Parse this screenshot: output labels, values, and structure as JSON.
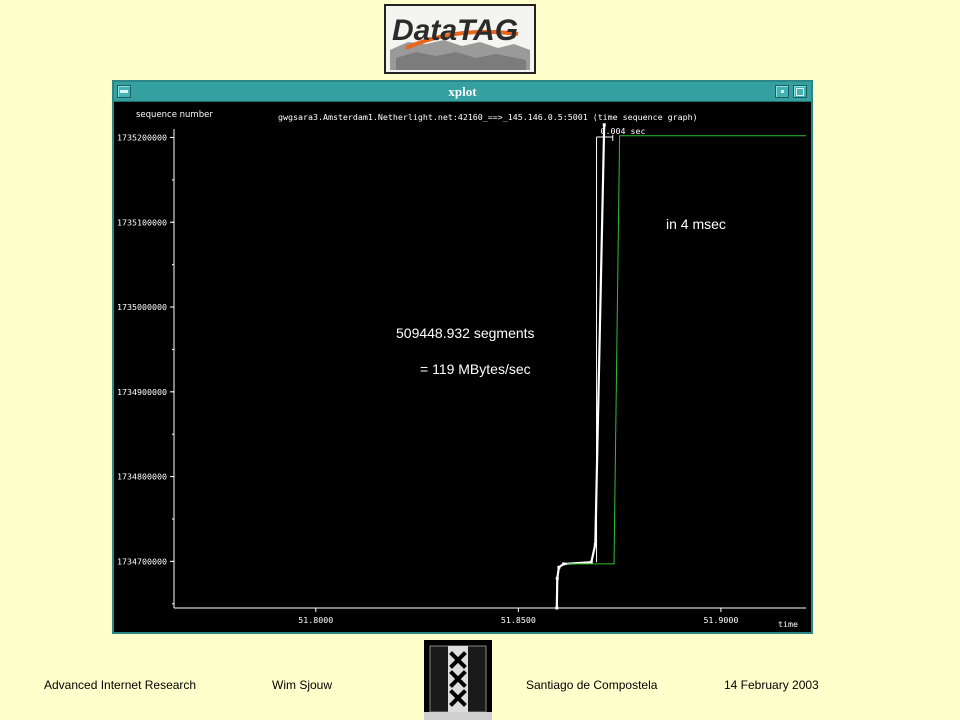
{
  "window": {
    "title": "xplot"
  },
  "plot": {
    "ylabel": "sequence number",
    "header": "gwgsara3.Amsterdam1.Netherlight.net:42160_==>_145.146.0.5:5001 (time sequence graph)",
    "xlabel": "time",
    "interval_label": "0.004 sec",
    "annotations": {
      "rate_duration": "in 4 msec",
      "segments": "509448.932 segments",
      "throughput": "= 119 MBytes/sec"
    }
  },
  "chart_data": {
    "type": "line",
    "xlim": [
      51.765,
      51.921
    ],
    "ylim": [
      1734645000,
      1735210000
    ],
    "x_ticks": [
      "51.8000",
      "51.8500",
      "51.9000"
    ],
    "x_tick_values": [
      51.8,
      51.85,
      51.9
    ],
    "y_ticks": [
      "1735200000",
      "1735100000",
      "1735000000",
      "1734900000",
      "1734800000",
      "1734700000"
    ],
    "y_tick_values": [
      1735200000,
      1735100000,
      1735000000,
      1734900000,
      1734800000,
      1734700000
    ],
    "series": [
      {
        "color": "#ffffff",
        "points": [
          [
            51.8595,
            1734645000
          ],
          [
            51.8596,
            1734680000
          ],
          [
            51.86,
            1734693000
          ],
          [
            51.8612,
            1734697000
          ],
          [
            51.868,
            1734699000
          ],
          [
            51.869,
            1734720000
          ],
          [
            51.8712,
            1735215000
          ]
        ]
      },
      {
        "color": "#2fbf2f",
        "points": [
          [
            51.862,
            1734697000
          ],
          [
            51.8736,
            1734697000
          ],
          [
            51.875,
            1735202000
          ],
          [
            51.921,
            1735202000
          ]
        ]
      }
    ],
    "interval_marker": {
      "x_start": 51.8693,
      "x_end": 51.8733
    }
  },
  "footer": {
    "institute": "Advanced Internet Research",
    "author": "Wim Sjouw",
    "location": "Santiago de Compostela",
    "date": "14 February 2003"
  },
  "colors": {
    "background": "#ffffcc",
    "titlebar": "#34a0a0",
    "plot_bg": "#000000",
    "datatag_orange": "#e8661c"
  },
  "logo": {
    "text": "DataTAG"
  }
}
